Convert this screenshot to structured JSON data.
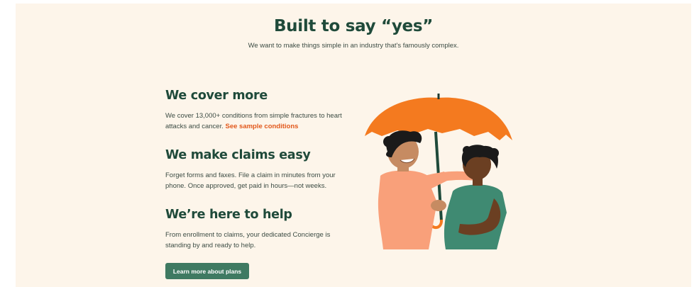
{
  "header": {
    "title": "Built to say “yes”",
    "subtitle": "We want to make things simple in an industry that's famously complex."
  },
  "features": [
    {
      "heading": "We cover more",
      "body": "We cover 13,000+ conditions from simple fractures to heart attacks and cancer.",
      "link": "See sample conditions"
    },
    {
      "heading": "We make claims easy",
      "body": "Forget forms and faxes. File a claim in minutes from your phone. Once approved, get paid in hours—not weeks."
    },
    {
      "heading": "We’re here to help",
      "body": "From enrollment to claims, your dedicated Concierge is standing by and ready to help."
    }
  ],
  "cta": {
    "label": "Learn more about plans"
  },
  "illustration": {
    "name": "two-people-under-umbrella-illustration"
  },
  "colors": {
    "background": "#fdf5ea",
    "heading": "#1f4a3a",
    "link": "#e2581b",
    "button": "#3f7a62",
    "umbrella": "#f47a1f"
  }
}
